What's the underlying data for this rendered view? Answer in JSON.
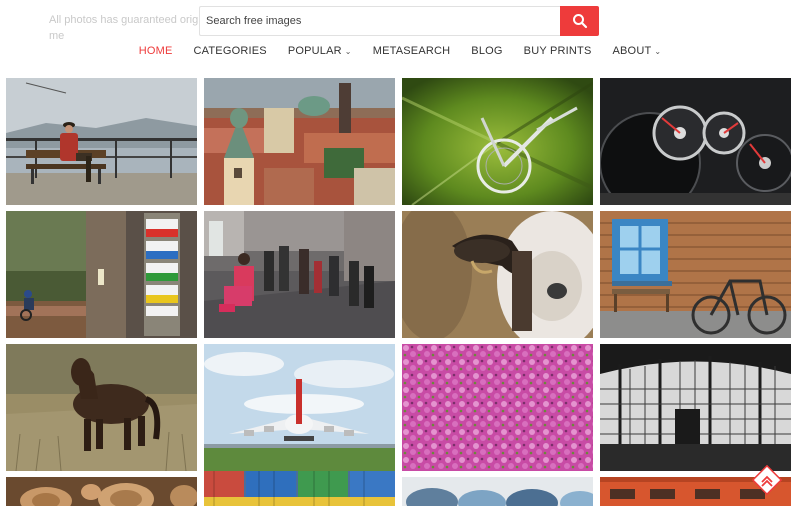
{
  "intro": {
    "line1": "All photos has guaranteed origin - all",
    "line2": "me"
  },
  "search": {
    "placeholder": "Search free images",
    "button_icon": "search-icon",
    "button_color": "#ee3b3b"
  },
  "nav": {
    "active_color": "#ee3b3b",
    "items": [
      {
        "label": "HOME"
      },
      {
        "label": "CATEGORIES"
      },
      {
        "label": "POPULAR"
      },
      {
        "label": "METASEARCH"
      },
      {
        "label": "BLOG"
      },
      {
        "label": "BUY PRINTS"
      },
      {
        "label": "ABOUT"
      }
    ]
  },
  "gallery": {
    "photos": [
      "man-on-bench-photo",
      "prague-rooftops-photo",
      "bicycle-motion-blur-photo",
      "car-dashboard-photo",
      "trail-marker-tree-photo",
      "tourists-photographing-photo",
      "sheep-closeup-photo",
      "bicycle-wooden-wall-photo",
      "brown-pony-photo",
      "airbus-a380-photo",
      "pink-flowers-photo",
      "train-station-roof-photo",
      "firewood-logs-photo",
      "shipping-containers-photo",
      "blue-eggs-photo",
      "red-train-photo"
    ]
  },
  "back_to_top": {
    "icon": "chevron-up-icon",
    "color": "#ee3b3b"
  }
}
